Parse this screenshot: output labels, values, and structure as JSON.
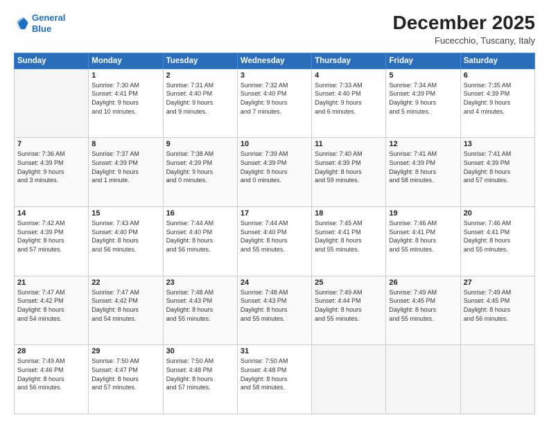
{
  "header": {
    "logo_line1": "General",
    "logo_line2": "Blue",
    "month": "December 2025",
    "location": "Fucecchio, Tuscany, Italy"
  },
  "days_of_week": [
    "Sunday",
    "Monday",
    "Tuesday",
    "Wednesday",
    "Thursday",
    "Friday",
    "Saturday"
  ],
  "weeks": [
    [
      {
        "day": "",
        "info": ""
      },
      {
        "day": "1",
        "info": "Sunrise: 7:30 AM\nSunset: 4:41 PM\nDaylight: 9 hours\nand 10 minutes."
      },
      {
        "day": "2",
        "info": "Sunrise: 7:31 AM\nSunset: 4:40 PM\nDaylight: 9 hours\nand 9 minutes."
      },
      {
        "day": "3",
        "info": "Sunrise: 7:32 AM\nSunset: 4:40 PM\nDaylight: 9 hours\nand 7 minutes."
      },
      {
        "day": "4",
        "info": "Sunrise: 7:33 AM\nSunset: 4:40 PM\nDaylight: 9 hours\nand 6 minutes."
      },
      {
        "day": "5",
        "info": "Sunrise: 7:34 AM\nSunset: 4:39 PM\nDaylight: 9 hours\nand 5 minutes."
      },
      {
        "day": "6",
        "info": "Sunrise: 7:35 AM\nSunset: 4:39 PM\nDaylight: 9 hours\nand 4 minutes."
      }
    ],
    [
      {
        "day": "7",
        "info": "Sunrise: 7:36 AM\nSunset: 4:39 PM\nDaylight: 9 hours\nand 3 minutes."
      },
      {
        "day": "8",
        "info": "Sunrise: 7:37 AM\nSunset: 4:39 PM\nDaylight: 9 hours\nand 1 minute."
      },
      {
        "day": "9",
        "info": "Sunrise: 7:38 AM\nSunset: 4:39 PM\nDaylight: 9 hours\nand 0 minutes."
      },
      {
        "day": "10",
        "info": "Sunrise: 7:39 AM\nSunset: 4:39 PM\nDaylight: 9 hours\nand 0 minutes."
      },
      {
        "day": "11",
        "info": "Sunrise: 7:40 AM\nSunset: 4:39 PM\nDaylight: 8 hours\nand 59 minutes."
      },
      {
        "day": "12",
        "info": "Sunrise: 7:41 AM\nSunset: 4:39 PM\nDaylight: 8 hours\nand 58 minutes."
      },
      {
        "day": "13",
        "info": "Sunrise: 7:41 AM\nSunset: 4:39 PM\nDaylight: 8 hours\nand 57 minutes."
      }
    ],
    [
      {
        "day": "14",
        "info": "Sunrise: 7:42 AM\nSunset: 4:39 PM\nDaylight: 8 hours\nand 57 minutes."
      },
      {
        "day": "15",
        "info": "Sunrise: 7:43 AM\nSunset: 4:40 PM\nDaylight: 8 hours\nand 56 minutes."
      },
      {
        "day": "16",
        "info": "Sunrise: 7:44 AM\nSunset: 4:40 PM\nDaylight: 8 hours\nand 56 minutes."
      },
      {
        "day": "17",
        "info": "Sunrise: 7:44 AM\nSunset: 4:40 PM\nDaylight: 8 hours\nand 55 minutes."
      },
      {
        "day": "18",
        "info": "Sunrise: 7:45 AM\nSunset: 4:41 PM\nDaylight: 8 hours\nand 55 minutes."
      },
      {
        "day": "19",
        "info": "Sunrise: 7:46 AM\nSunset: 4:41 PM\nDaylight: 8 hours\nand 55 minutes."
      },
      {
        "day": "20",
        "info": "Sunrise: 7:46 AM\nSunset: 4:41 PM\nDaylight: 8 hours\nand 55 minutes."
      }
    ],
    [
      {
        "day": "21",
        "info": "Sunrise: 7:47 AM\nSunset: 4:42 PM\nDaylight: 8 hours\nand 54 minutes."
      },
      {
        "day": "22",
        "info": "Sunrise: 7:47 AM\nSunset: 4:42 PM\nDaylight: 8 hours\nand 54 minutes."
      },
      {
        "day": "23",
        "info": "Sunrise: 7:48 AM\nSunset: 4:43 PM\nDaylight: 8 hours\nand 55 minutes."
      },
      {
        "day": "24",
        "info": "Sunrise: 7:48 AM\nSunset: 4:43 PM\nDaylight: 8 hours\nand 55 minutes."
      },
      {
        "day": "25",
        "info": "Sunrise: 7:49 AM\nSunset: 4:44 PM\nDaylight: 8 hours\nand 55 minutes."
      },
      {
        "day": "26",
        "info": "Sunrise: 7:49 AM\nSunset: 4:45 PM\nDaylight: 8 hours\nand 55 minutes."
      },
      {
        "day": "27",
        "info": "Sunrise: 7:49 AM\nSunset: 4:45 PM\nDaylight: 8 hours\nand 56 minutes."
      }
    ],
    [
      {
        "day": "28",
        "info": "Sunrise: 7:49 AM\nSunset: 4:46 PM\nDaylight: 8 hours\nand 56 minutes."
      },
      {
        "day": "29",
        "info": "Sunrise: 7:50 AM\nSunset: 4:47 PM\nDaylight: 8 hours\nand 57 minutes."
      },
      {
        "day": "30",
        "info": "Sunrise: 7:50 AM\nSunset: 4:48 PM\nDaylight: 8 hours\nand 57 minutes."
      },
      {
        "day": "31",
        "info": "Sunrise: 7:50 AM\nSunset: 4:48 PM\nDaylight: 8 hours\nand 58 minutes."
      },
      {
        "day": "",
        "info": ""
      },
      {
        "day": "",
        "info": ""
      },
      {
        "day": "",
        "info": ""
      }
    ]
  ]
}
